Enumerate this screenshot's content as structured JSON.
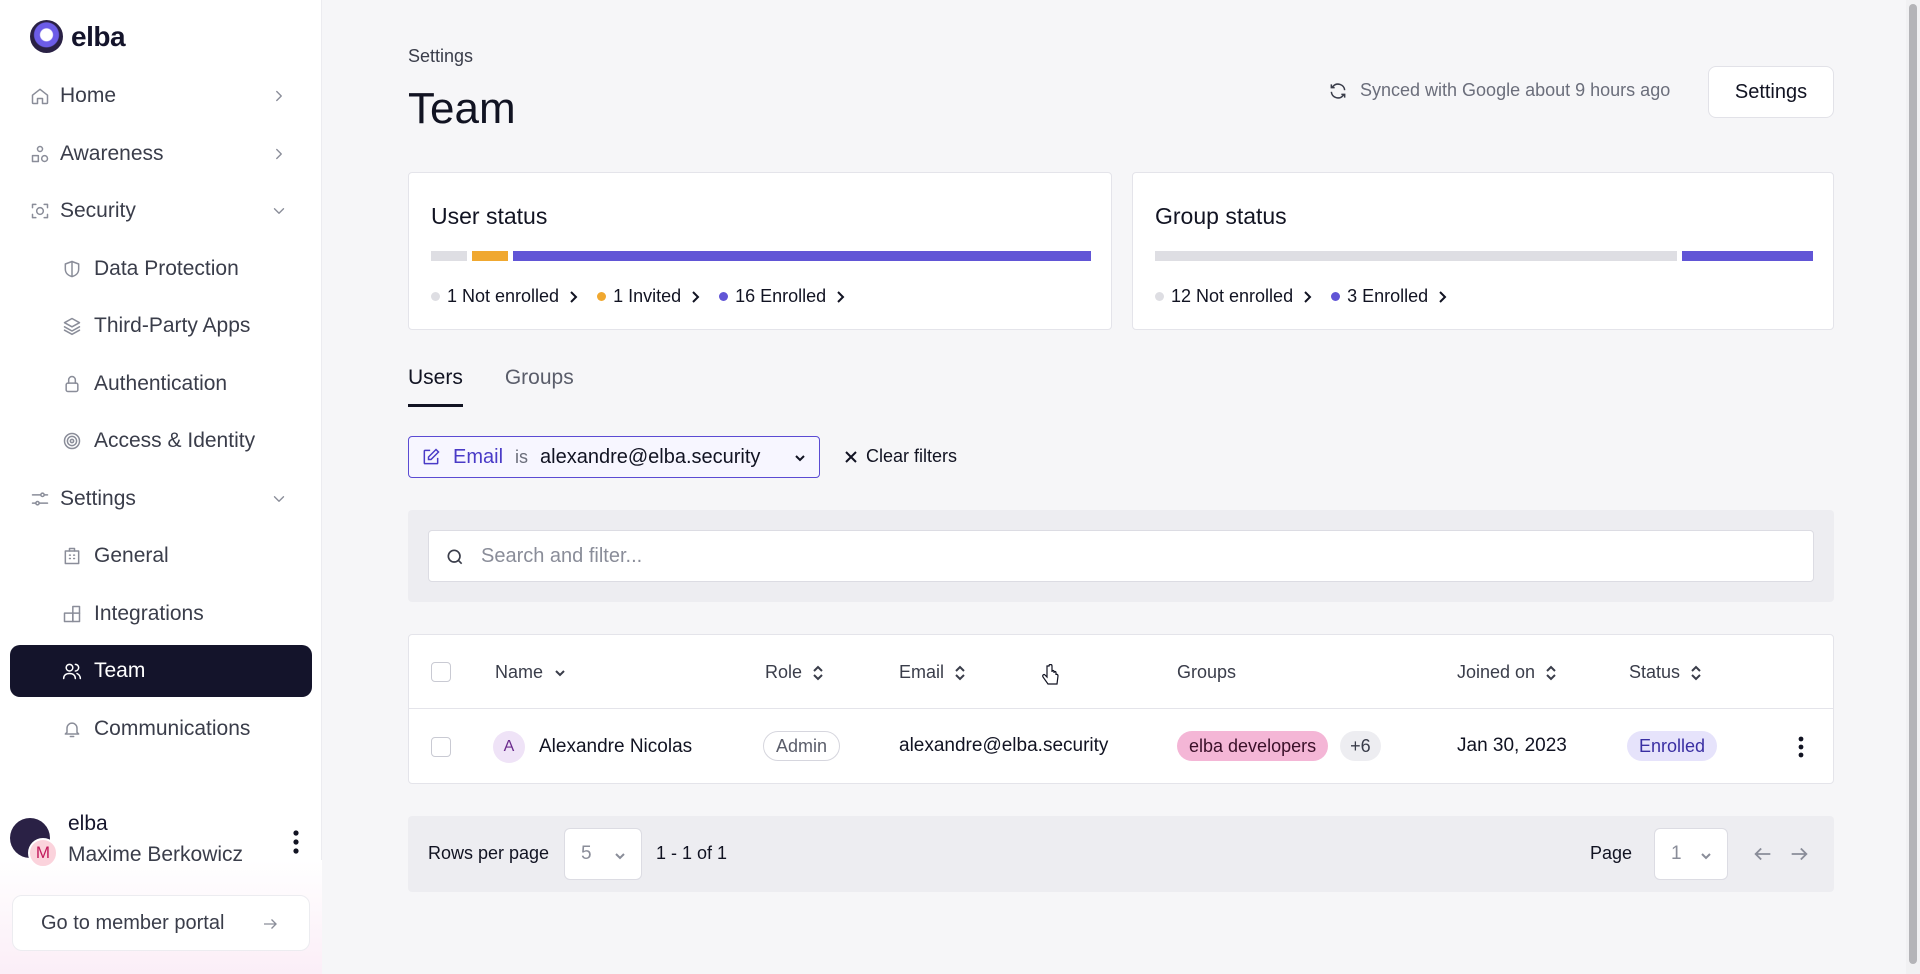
{
  "brand": {
    "name": "elba",
    "accent": "#5b4bd3",
    "dark": "#14142b"
  },
  "sidebar": {
    "items": [
      {
        "label": "Home",
        "icon": "home-icon",
        "chevron": "chevron-right"
      },
      {
        "label": "Awareness",
        "icon": "awareness-icon",
        "chevron": "chevron-right"
      },
      {
        "label": "Security",
        "icon": "scan-icon",
        "chevron": "chevron-down"
      },
      {
        "label": "Data Protection",
        "icon": "shield-icon",
        "sub": true
      },
      {
        "label": "Third-Party Apps",
        "icon": "layers-icon",
        "sub": true
      },
      {
        "label": "Authentication",
        "icon": "lock-icon",
        "sub": true
      },
      {
        "label": "Access & Identity",
        "icon": "fingerprint-icon",
        "sub": true
      },
      {
        "label": "Settings",
        "icon": "sliders-icon",
        "chevron": "chevron-down"
      },
      {
        "label": "General",
        "icon": "building-icon",
        "sub": true
      },
      {
        "label": "Integrations",
        "icon": "blocks-icon",
        "sub": true
      },
      {
        "label": "Team",
        "icon": "users-icon",
        "sub": true,
        "active": true
      },
      {
        "label": "Communications",
        "icon": "bell-icon",
        "sub": true
      }
    ],
    "profile": {
      "org": "elba",
      "name": "Maxime Berkowicz",
      "avatar_initial": "M"
    },
    "portal_button": "Go to member portal"
  },
  "header": {
    "breadcrumb": "Settings",
    "title": "Team",
    "sync_text": "Synced with Google about 9 hours ago",
    "settings_button": "Settings"
  },
  "user_status": {
    "title": "User status",
    "not_enrolled": "1 Not enrolled",
    "invited": "1 Invited",
    "enrolled": "16 Enrolled",
    "counts": {
      "not_enrolled": 1,
      "invited": 1,
      "enrolled": 16
    },
    "colors": {
      "not_enrolled": "#dedee3",
      "invited": "#f0a830",
      "enrolled": "#6155d6"
    }
  },
  "group_status": {
    "title": "Group status",
    "not_enrolled": "12 Not enrolled",
    "enrolled": "3 Enrolled",
    "counts": {
      "not_enrolled": 12,
      "enrolled": 3
    },
    "colors": {
      "not_enrolled": "#dedee3",
      "enrolled": "#6155d6"
    }
  },
  "tabs": [
    {
      "label": "Users",
      "active": true
    },
    {
      "label": "Groups",
      "active": false
    }
  ],
  "filter": {
    "field": "Email",
    "operator": "is",
    "value": "alexandre@elba.security",
    "clear_label": "Clear filters"
  },
  "search": {
    "placeholder": "Search and filter..."
  },
  "table": {
    "columns": [
      "Name",
      "Role",
      "Email",
      "Groups",
      "Joined on",
      "Status"
    ],
    "rows": [
      {
        "initial": "A",
        "name": "Alexandre Nicolas",
        "role": "Admin",
        "email": "alexandre@elba.security",
        "group": "elba developers",
        "more_groups": "+6",
        "joined": "Jan 30, 2023",
        "status": "Enrolled"
      }
    ]
  },
  "pagination": {
    "rows_per_page_label": "Rows per page",
    "rows_per_page": "5",
    "range": "1 - 1 of 1",
    "page_label": "Page",
    "page": "1"
  }
}
